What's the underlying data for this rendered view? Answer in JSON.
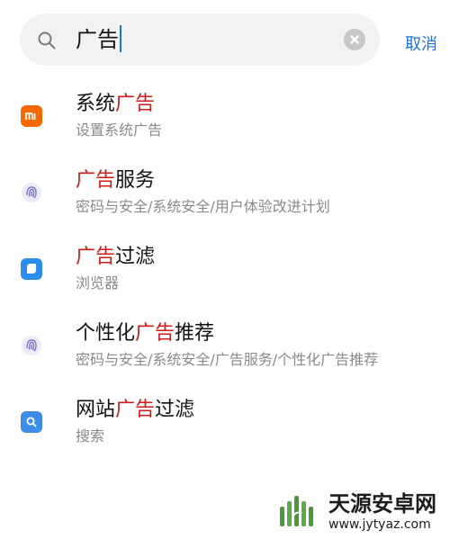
{
  "search": {
    "query": "广告",
    "cancel_label": "取消"
  },
  "results": [
    {
      "icon": "mi-logo-icon",
      "title_parts": [
        "系统",
        "广告",
        ""
      ],
      "subtitle": "设置系统广告"
    },
    {
      "icon": "fingerprint-icon",
      "title_parts": [
        "",
        "广告",
        "服务"
      ],
      "subtitle": "密码与安全/系统安全/用户体验改进计划"
    },
    {
      "icon": "browser-icon",
      "title_parts": [
        "",
        "广告",
        "过滤"
      ],
      "subtitle": "浏览器"
    },
    {
      "icon": "fingerprint-icon",
      "title_parts": [
        "个性化",
        "广告",
        "推荐"
      ],
      "subtitle": "密码与安全/系统安全/广告服务/个性化广告推荐"
    },
    {
      "icon": "search-app-icon",
      "title_parts": [
        "网站",
        "广告",
        "过滤"
      ],
      "subtitle": "搜索"
    }
  ],
  "watermark": {
    "title": "天源安卓网",
    "url": "www.jytyaz.com"
  },
  "colors": {
    "accent": "#1a73e8",
    "highlight": "#d11a1a",
    "mi_orange": "#f56a00",
    "browser_blue": "#2d8cf0",
    "search_blue": "#3d8de8",
    "fingerprint_purple": "#7a77c8"
  }
}
